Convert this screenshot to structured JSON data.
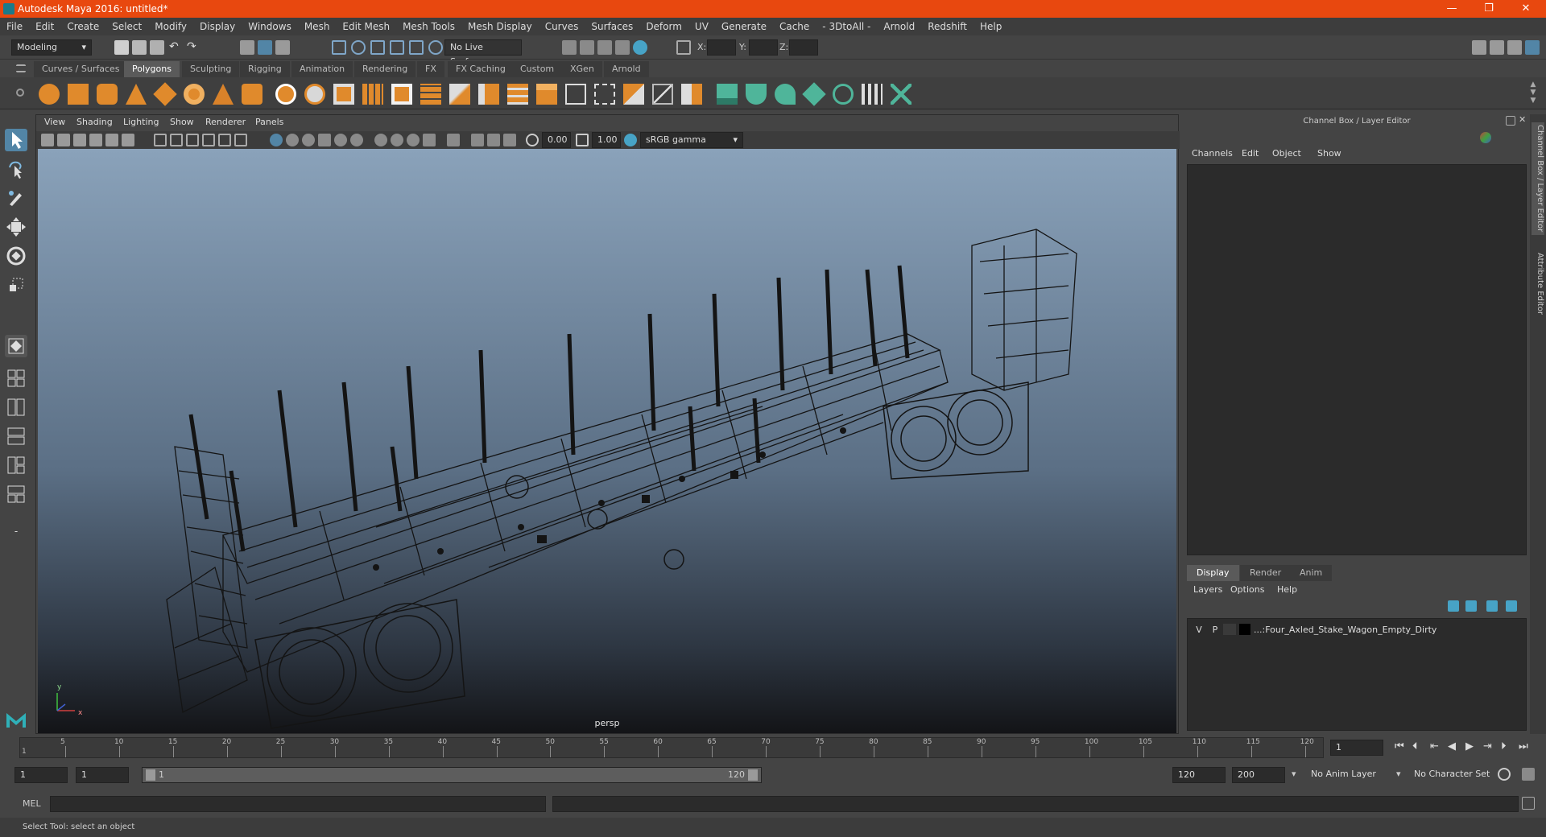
{
  "title": "Autodesk Maya 2016: untitled*",
  "window_controls": {
    "minimize": "—",
    "restore": "❐",
    "close": "✕"
  },
  "menus": [
    "File",
    "Edit",
    "Create",
    "Select",
    "Modify",
    "Display",
    "Windows",
    "Mesh",
    "Edit Mesh",
    "Mesh Tools",
    "Mesh Display",
    "Curves",
    "Surfaces",
    "Deform",
    "UV",
    "Generate",
    "Cache",
    "- 3DtoAll -",
    "Arnold",
    "Redshift",
    "Help"
  ],
  "statusline": {
    "mode": "Modeling",
    "live_surface": "No Live Surface",
    "x_label": "X:",
    "y_label": "Y:",
    "z_label": "Z:"
  },
  "shelf_tabs": [
    "Curves / Surfaces",
    "Polygons",
    "Sculpting",
    "Rigging",
    "Animation",
    "Rendering",
    "FX",
    "FX Caching",
    "Custom",
    "XGen",
    "Arnold"
  ],
  "active_shelf": "Polygons",
  "viewport": {
    "menus": [
      "View",
      "Shading",
      "Lighting",
      "Show",
      "Renderer",
      "Panels"
    ],
    "exposure": "0.00",
    "gamma": "1.00",
    "color_space": "sRGB gamma",
    "camera": "persp",
    "axis_x": "x",
    "axis_y": "y"
  },
  "channel_box": {
    "header": "Channel Box / Layer Editor",
    "menus": [
      "Channels",
      "Edit",
      "Object",
      "Show"
    ]
  },
  "layer_editor": {
    "tabs": [
      "Display",
      "Render",
      "Anim"
    ],
    "active_tab": "Display",
    "menus": [
      "Layers",
      "Options",
      "Help"
    ],
    "layer": {
      "v": "V",
      "p": "P",
      "name": "...:Four_Axled_Stake_Wagon_Empty_Dirty"
    }
  },
  "side_tabs": [
    "Channel Box / Layer Editor",
    "Attribute Editor"
  ],
  "timeline": {
    "current_frame_marker": "1",
    "ticks": [
      "5",
      "10",
      "15",
      "20",
      "25",
      "30",
      "35",
      "40",
      "45",
      "50",
      "55",
      "60",
      "65",
      "70",
      "75",
      "80",
      "85",
      "90",
      "95",
      "100",
      "105",
      "110",
      "115",
      "120"
    ],
    "current_frame": "1"
  },
  "range": {
    "start": "1",
    "playback_start": "1",
    "slider_start": "1",
    "slider_end": "120",
    "playback_end": "120",
    "end": "200",
    "anim_layer": "No Anim Layer",
    "character_set": "No Character Set"
  },
  "mel": {
    "label": "MEL"
  },
  "help_line": "Select Tool: select an object",
  "colors": {
    "title_bar": "#e8480f",
    "shelf_orange": "#e08a2c",
    "shelf_green": "#4fb59a",
    "active_tool": "#5285a6"
  }
}
